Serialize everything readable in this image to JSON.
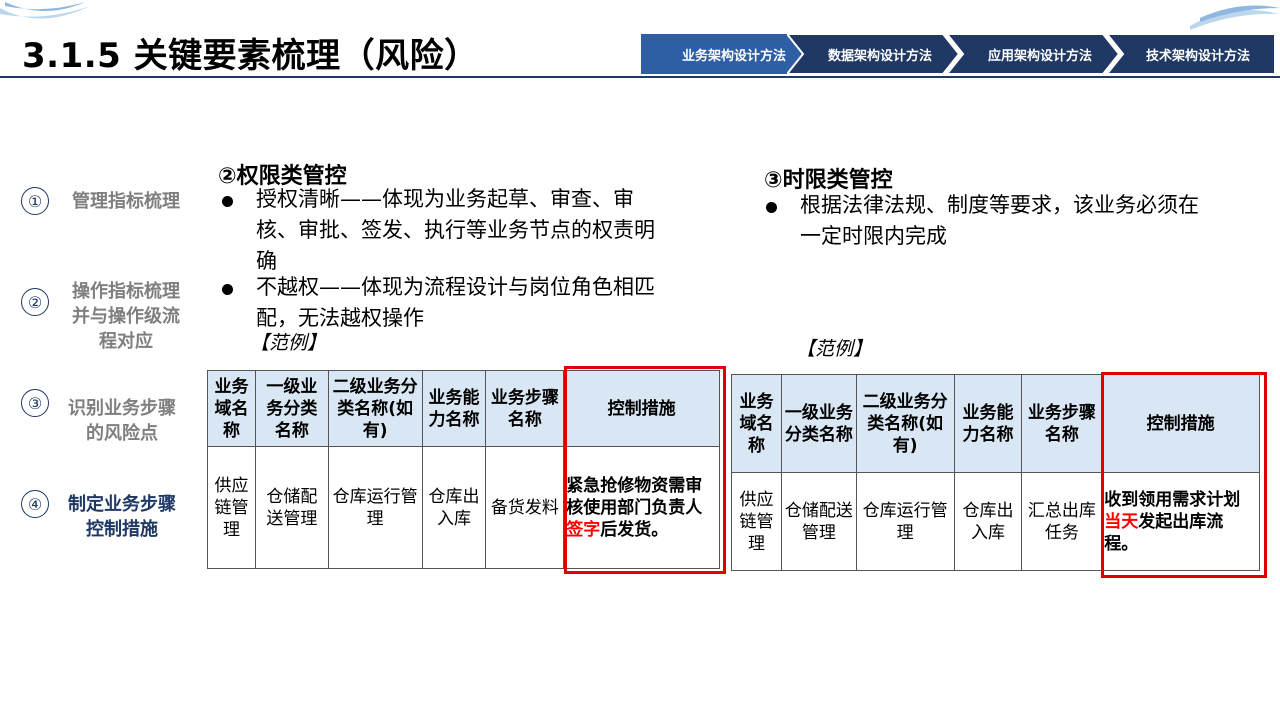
{
  "page": {
    "title": "3.1.5 关键要素梳理（风险）"
  },
  "nav": {
    "items": [
      {
        "label": "业务架构设计方法",
        "active": true
      },
      {
        "label": "数据架构设计方法",
        "active": false
      },
      {
        "label": "应用架构设计方法",
        "active": false
      },
      {
        "label": "技术架构设计方法",
        "active": false
      }
    ],
    "colors": {
      "active": "#2e5fa5",
      "inactive": "#1f3864"
    }
  },
  "steps": [
    {
      "num": "①",
      "text": "管理指标梳理"
    },
    {
      "num": "②",
      "text": "操作指标梳理并与操作级流程对应"
    },
    {
      "num": "③",
      "text": "识别业务步骤的风险点"
    },
    {
      "num": "④",
      "text": "制定业务步骤控制措施"
    }
  ],
  "section2": {
    "title": "②权限类管控",
    "bullet1": "授权清晰——体现为业务起草、审查、审核、审批、签发、执行等业务节点的权责明确",
    "bullet2": "不越权——体现为流程设计与岗位角色相匹配，无法越权操作",
    "example": "【范例】",
    "table": {
      "headers": [
        "业务域名称",
        "一级业务分类名称",
        "二级业务分类名称(如有)",
        "业务能力名称",
        "业务步骤名称",
        "控制措施"
      ],
      "row": [
        "供应链管理",
        "仓储配送管理",
        "仓库运行管理",
        "仓库出入库",
        "备货发料"
      ],
      "measure_pre": "紧急抢修物资需审核使用部门负责人",
      "measure_red": "签字",
      "measure_post": "后发货。"
    }
  },
  "section3": {
    "title": "③时限类管控",
    "bullet1": "根据法律法规、制度等要求，该业务必须在一定时限内完成",
    "example": "【范例】",
    "table": {
      "headers": [
        "业务域名称",
        "一级业务分类名称",
        "二级业务分类名称(如有)",
        "业务能力名称",
        "业务步骤名称",
        "控制措施"
      ],
      "row": [
        "供应链管理",
        "仓储配送管理",
        "仓库运行管理",
        "仓库出入库",
        "汇总出库任务"
      ],
      "measure_pre": "收到领用需求计划",
      "measure_red": "当天",
      "measure_post": "发起出库流程。"
    }
  }
}
